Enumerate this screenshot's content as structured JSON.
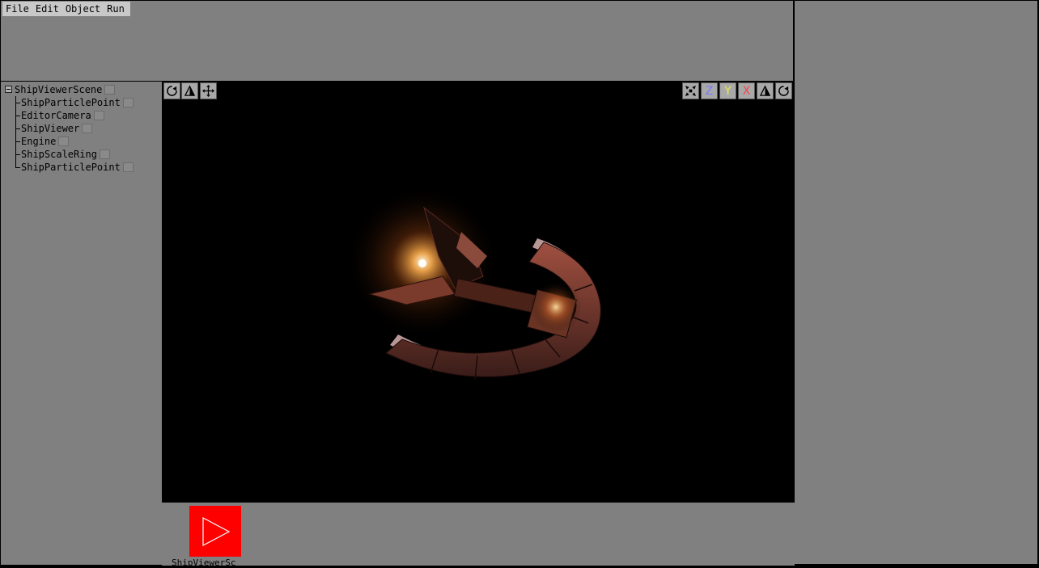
{
  "menu": [
    "File",
    "Edit",
    "Object",
    "Run"
  ],
  "scene_tree": {
    "root": "ShipViewerScene",
    "children": [
      "ShipParticlePoint",
      "EditorCamera",
      "ShipViewer",
      "Engine",
      "ShipScaleRing",
      "ShipParticlePoint"
    ]
  },
  "viewport": {
    "left_tools": [
      "rotate-icon",
      "perspective-icon",
      "move-icon"
    ],
    "right_tools": [
      "fit-icon",
      "Z",
      "Y",
      "X",
      "perspective-icon",
      "rotate-icon"
    ],
    "axis_colors": {
      "Z": "#7a7aff",
      "Y": "#e8e84a",
      "X": "#ff4040"
    }
  },
  "bottom": {
    "run_caption": "ShipViewerSc"
  }
}
